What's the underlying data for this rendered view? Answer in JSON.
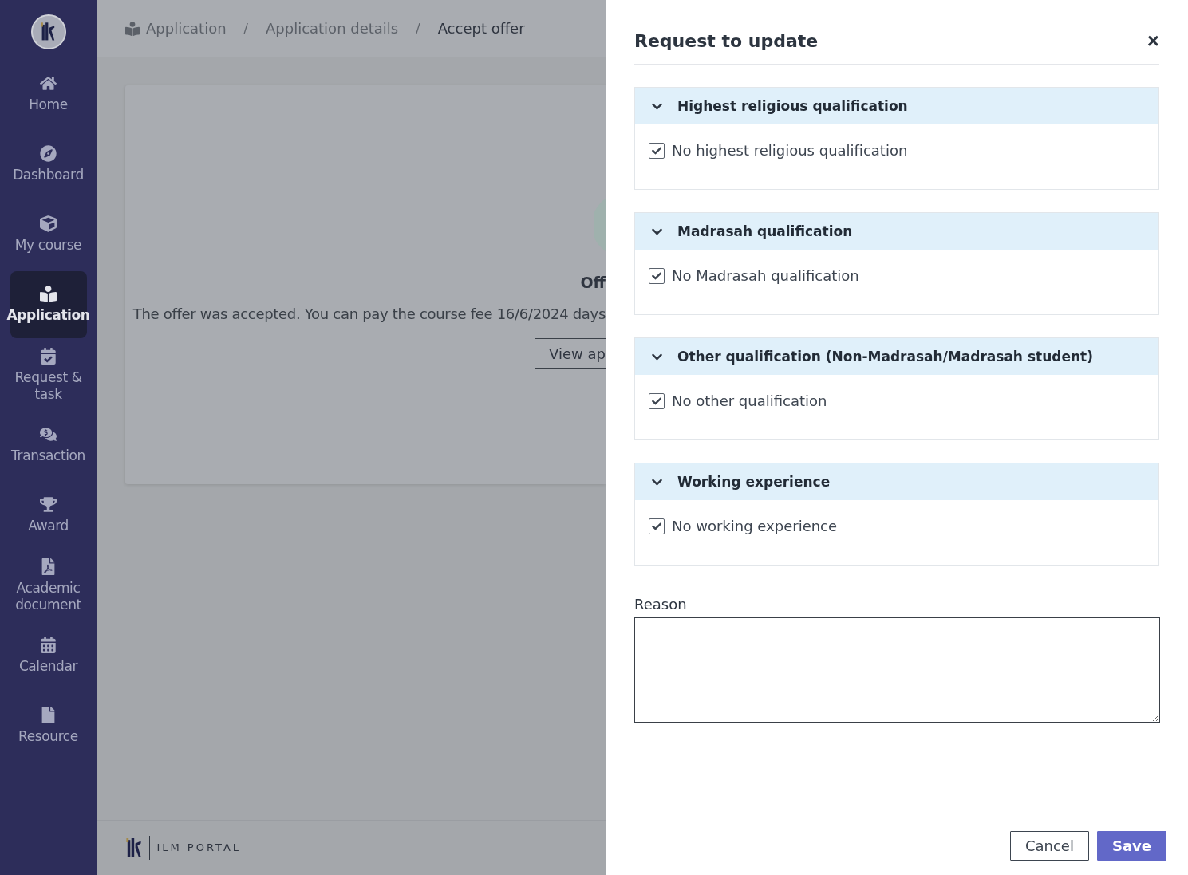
{
  "sidebar": {
    "items": [
      {
        "label": "Home",
        "selected": false
      },
      {
        "label": "Dashboard",
        "selected": false
      },
      {
        "label": "My course",
        "selected": false
      },
      {
        "label": "Application",
        "selected": true
      },
      {
        "label": "Request & task",
        "selected": false
      },
      {
        "label": "Transaction",
        "selected": false
      },
      {
        "label": "Award",
        "selected": false
      },
      {
        "label": "Academic document",
        "selected": false
      },
      {
        "label": "Calendar",
        "selected": false
      },
      {
        "label": "Resource",
        "selected": false
      }
    ]
  },
  "breadcrumbs": [
    {
      "label": "Application",
      "current": false
    },
    {
      "separator": "/",
      "label": "Application details",
      "current": false
    },
    {
      "separator": "/",
      "label": "Accept offer",
      "current": true
    }
  ],
  "card": {
    "title": "Off",
    "message": "The offer was accepted. You can pay the course fee 16/6/2024 days",
    "button": "View ap"
  },
  "footer": {
    "brand": "ILM PORTAL"
  },
  "drawer": {
    "title": "Request to update",
    "close": "×",
    "sections": [
      {
        "title": "Highest religious qualification",
        "expanded": true,
        "option": {
          "label": "No highest religious qualification",
          "checked": true
        }
      },
      {
        "title": "Madrasah qualification",
        "expanded": true,
        "option": {
          "label": "No Madrasah qualification",
          "checked": true
        }
      },
      {
        "title": "Other qualification (Non-Madrasah/Madrasah student)",
        "expanded": true,
        "option": {
          "label": "No other qualification",
          "checked": true
        }
      },
      {
        "title": "Working experience",
        "expanded": true,
        "option": {
          "label": "No working experience",
          "checked": true
        }
      }
    ],
    "reason": {
      "label": "Reason"
    },
    "buttons": [
      {
        "label": "Cancel",
        "kind": "secondary"
      },
      {
        "label": "Save",
        "kind": "primary"
      }
    ]
  }
}
